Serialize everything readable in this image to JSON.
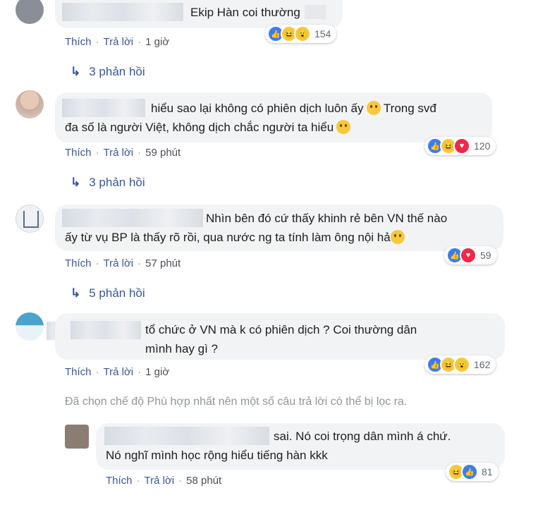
{
  "comments": [
    {
      "text_lines": [
        "Ekip Hàn coi thường"
      ],
      "like_label": "Thích",
      "reply_label": "Trả lời",
      "time": "1 giờ",
      "reaction_count": "154",
      "replies_label": "3 phản hồi"
    },
    {
      "text_lines": [
        "hiểu sao lại không có phiên dịch luôn ấy",
        "Trong svđ",
        "đa số là người Việt, không dịch chắc người ta hiểu"
      ],
      "like_label": "Thích",
      "reply_label": "Trả lời",
      "time": "59 phút",
      "reaction_count": "120",
      "replies_label": "3 phản hồi"
    },
    {
      "text_lines": [
        "Nhìn bên đó cứ thấy khinh rẻ bên VN thế nào",
        "ấy từ vụ BP là thấy rõ rồi, qua nước ng ta tính làm ông nội hả"
      ],
      "like_label": "Thích",
      "reply_label": "Trả lời",
      "time": "57 phút",
      "reaction_count": "59",
      "replies_label": "5 phản hồi"
    },
    {
      "text_lines": [
        "tổ chức ở VN mà k có phiên dịch ? Coi thường dân",
        "mình hay gì ?"
      ],
      "like_label": "Thích",
      "reply_label": "Trả lời",
      "time": "1 giờ",
      "reaction_count": "162"
    }
  ],
  "filter_note": "Đã chọn chế độ Phù hợp nhất nên một số câu trả lời có thể bị lọc ra.",
  "reply": {
    "text_lines": [
      "sai. Nó coi trọng dân mình á chứ.",
      "Nó nghĩ mình học rộng hiểu tiếng hàn kkk"
    ],
    "like_label": "Thích",
    "reply_label": "Trả lời",
    "time": "58 phút",
    "reaction_count": "81"
  },
  "colors": {
    "link": "#385898",
    "bubble": "#f2f3f5",
    "muted": "#90949c"
  }
}
